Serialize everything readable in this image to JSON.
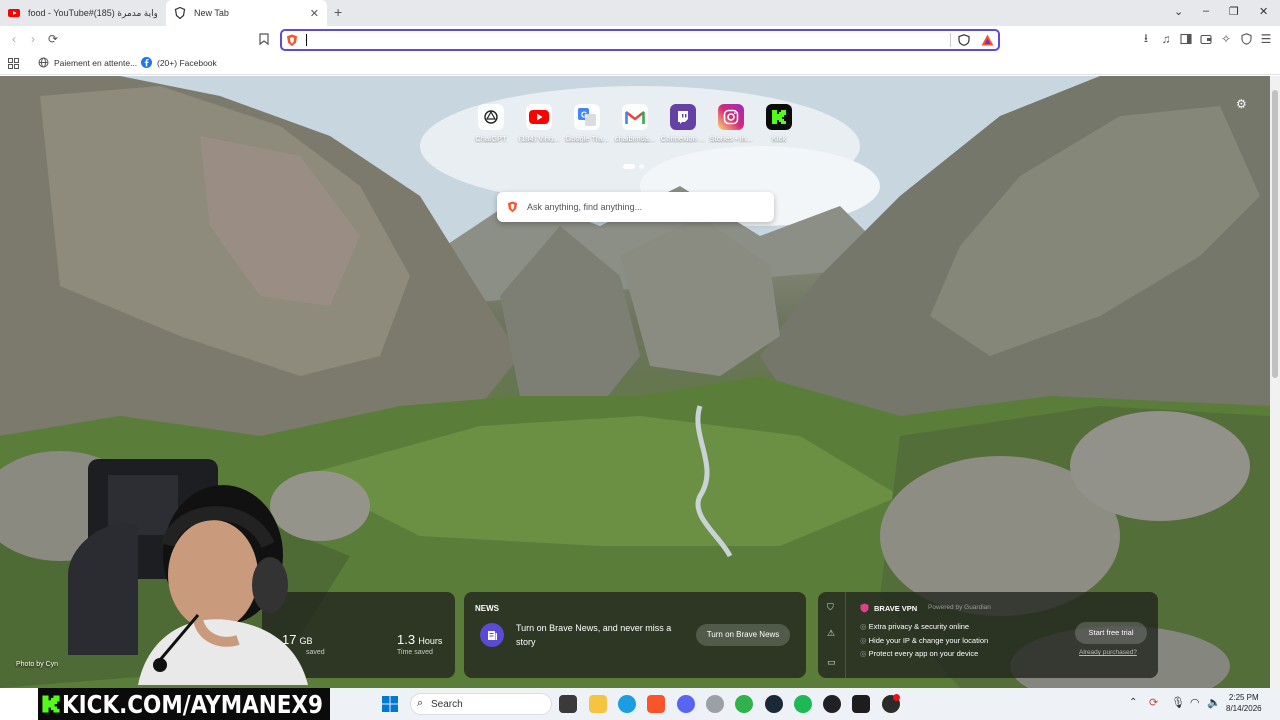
{
  "tabs": [
    {
      "title": "food - YouTube#شواية مدمرة (185)",
      "active": false
    },
    {
      "title": "New Tab",
      "active": true
    }
  ],
  "window_controls": {
    "chevron": "⌄",
    "minimize": "–",
    "maximize": "❐",
    "close": "✕"
  },
  "address_bar": {
    "value": "",
    "placeholder": ""
  },
  "bookmarks": [
    {
      "label": "Paiement en attente..."
    },
    {
      "label": "(20+) Facebook"
    }
  ],
  "top_sites": [
    {
      "label": "ChatGPT",
      "icon": "chatgpt-icon",
      "color": "#ffffff"
    },
    {
      "label": "(184) Ving...",
      "icon": "youtube-icon",
      "color": "#ff0000"
    },
    {
      "label": "Google Tra...",
      "icon": "google-translate-icon",
      "color": "#4285f4"
    },
    {
      "label": "chaibimda...",
      "icon": "gmail-icon",
      "color": "#ea4335"
    },
    {
      "label": "Connexion ...",
      "icon": "twitch-icon",
      "color": "#6441a5"
    },
    {
      "label": "Stories • In...",
      "icon": "instagram-icon",
      "color": "#d62976"
    },
    {
      "label": "Kick",
      "icon": "kick-icon",
      "color": "#53fc18"
    }
  ],
  "search": {
    "placeholder": "Ask anything, find anything..."
  },
  "stats": {
    "bandwidth_value": "17",
    "bandwidth_unit": "GB",
    "bandwidth_label": "saved",
    "time_value": "1.3",
    "time_unit": "Hours",
    "time_label": "Time saved"
  },
  "news": {
    "heading": "NEWS",
    "text": "Turn on Brave News, and never miss a story",
    "button": "Turn on Brave News"
  },
  "vpn": {
    "title": "BRAVE VPN",
    "powered_by": "Powered by",
    "partner": "Guardian",
    "features": [
      "Extra privacy & security online",
      "Hide your IP & change your location",
      "Protect every app on your device"
    ],
    "button": "Start free trial",
    "link": "Already purchased?"
  },
  "photo_credit": "Photo by Cyn",
  "stream_banner": "KICK.COM/AYMANEX9",
  "taskbar": {
    "search_label": "Search",
    "time": "2:25 PM",
    "date": "8/14/2026"
  },
  "colors": {
    "accent": "#5f4ad9",
    "brave_orange": "#fb542b",
    "kick_green": "#53fc18"
  }
}
